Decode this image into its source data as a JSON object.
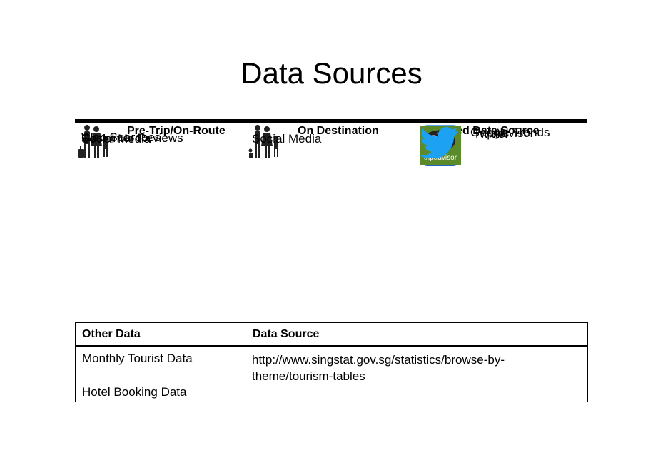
{
  "title": "Data Sources",
  "sources_table": {
    "headers": [
      "Pre-Trip/On-Route",
      "On Destination",
      "Selected Data Source"
    ],
    "rows": [
      {
        "pre_trip": "Web Searches",
        "on_destination": "",
        "selected": "Google Trends",
        "icon": "google-trends-icon"
      },
      {
        "pre_trip": "Customer Reviews",
        "on_destination": "",
        "selected": "TripAdvisor",
        "icon": "tripadvisor-icon"
      },
      {
        "pre_trip": "Social Media",
        "on_destination": "Social Media",
        "selected": "Twitter",
        "icon": "twitter-icon"
      }
    ]
  },
  "other_table": {
    "headers": [
      "Other Data",
      "Data Source"
    ],
    "other_data": [
      "Monthly Tourist Data",
      "Hotel Booking Data"
    ],
    "source_url": "http://www.singstat.gov.sg/statistics/browse-by-theme/tourism-tables"
  },
  "logo_text": {
    "tripadvisor": "tripadvisor"
  },
  "colors": {
    "google_trends_blue": "#2f7fd8",
    "tripadvisor_green": "#5a8a2a",
    "twitter_blue": "#1da1f2"
  }
}
